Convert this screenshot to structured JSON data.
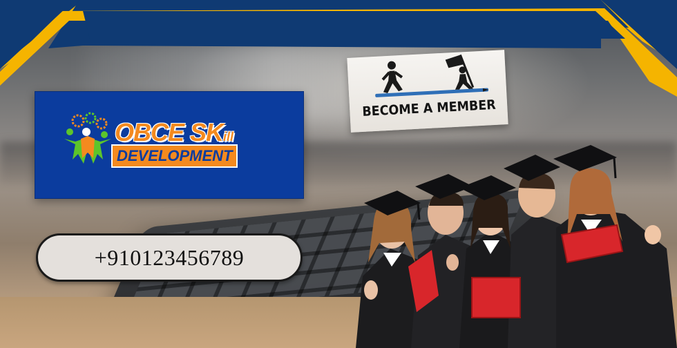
{
  "banner": {
    "logo": {
      "word_top": "OBCE SK",
      "word_top_suffix": "ill",
      "word_bottom": "DEVELOPMENT"
    },
    "phone": "+910123456789",
    "member_cta": "BECOME A MEMBER",
    "icons": {
      "walker": "walking-person-icon",
      "flag": "flag-climber-icon",
      "gears": "gears-people-icon"
    },
    "colors": {
      "navy": "#0f3a73",
      "yellow": "#f5b400",
      "logo_blue": "#0b3c9e",
      "logo_orange": "#f48a1f",
      "logo_green": "#5cc52b",
      "red_book": "#d8262b"
    }
  }
}
